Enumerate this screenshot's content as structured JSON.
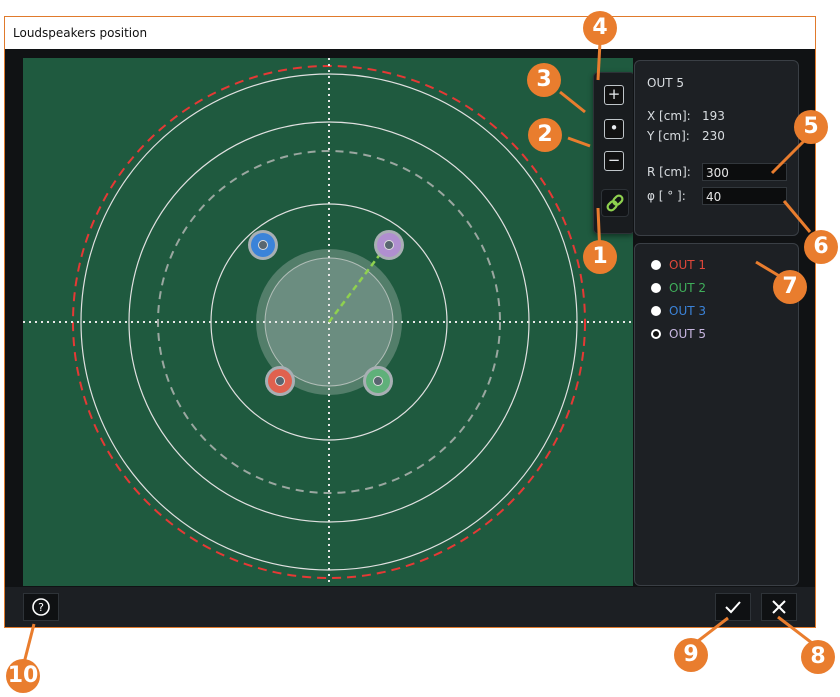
{
  "window": {
    "title": "Loudspeakers position"
  },
  "selected_output": {
    "name": "OUT 5",
    "x_label": "X [cm]:",
    "x_value": "193",
    "y_label": "Y [cm]:",
    "y_value": "230",
    "r_label": "R [cm]:",
    "r_value": "300",
    "phi_label": "φ [ ° ]:",
    "phi_value": "40"
  },
  "outputs": [
    {
      "label": "OUT 1",
      "color": "#e0473a",
      "selected": false
    },
    {
      "label": "OUT 2",
      "color": "#3fae5a",
      "selected": false
    },
    {
      "label": "OUT 3",
      "color": "#3b83d9",
      "selected": false
    },
    {
      "label": "OUT 5",
      "color": "#c7b6e0",
      "selected": true
    }
  ],
  "toolbox": {
    "zoom_in": "+",
    "zoom_fit": "•",
    "zoom_out": "−"
  },
  "buttons": {
    "help": "?",
    "ok": "✓",
    "close": "✕"
  },
  "callouts": [
    "1",
    "2",
    "3",
    "4",
    "5",
    "6",
    "7",
    "8",
    "9",
    "10"
  ],
  "colors": {
    "accent": "#e97d2e",
    "canvas": "#1f5a3f",
    "speaker_blue": "#3b83d9",
    "speaker_purple": "#b08fd0",
    "speaker_red": "#e0614f",
    "speaker_green": "#5fb07a"
  }
}
